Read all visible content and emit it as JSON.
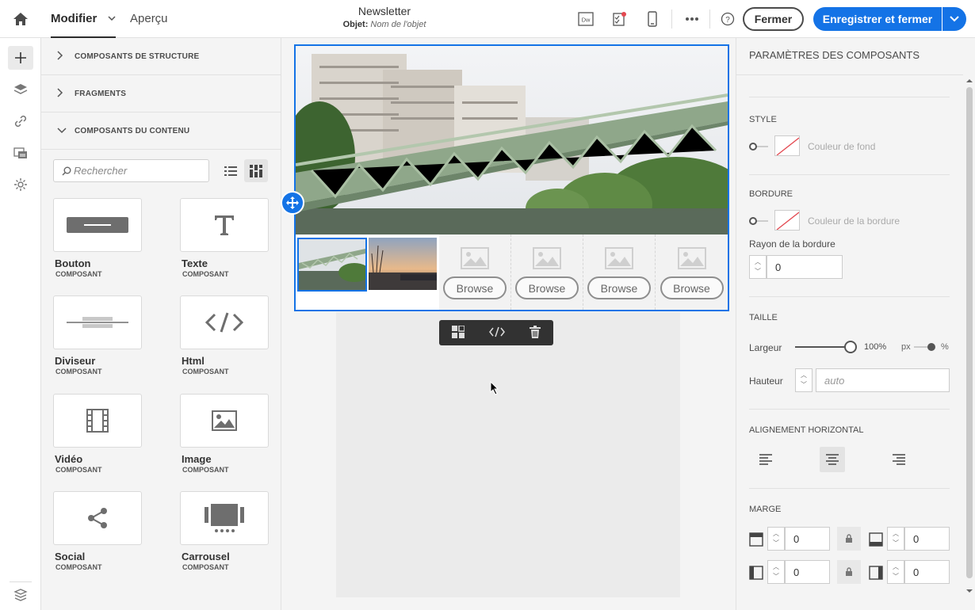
{
  "header": {
    "tab_modifier": "Modifier",
    "tab_apercu": "Aperçu",
    "title": "Newsletter",
    "subject_label": "Objet:",
    "subject_placeholder": "Nom de l'objet",
    "btn_fermer": "Fermer",
    "btn_save": "Enregistrer et fermer",
    "dw_icon": "Dw"
  },
  "panel": {
    "sections": [
      "COMPOSANTS DE STRUCTURE",
      "FRAGMENTS",
      "COMPOSANTS DU CONTENU"
    ],
    "search_placeholder": "Rechercher",
    "components": [
      {
        "name": "Bouton",
        "kind": "COMPOSANT",
        "icon": "button-icon"
      },
      {
        "name": "Texte",
        "kind": "COMPOSANT",
        "icon": "text-icon"
      },
      {
        "name": "Diviseur",
        "kind": "COMPOSANT",
        "icon": "divider-icon"
      },
      {
        "name": "Html",
        "kind": "COMPOSANT",
        "icon": "code-icon"
      },
      {
        "name": "Vidéo",
        "kind": "COMPOSANT",
        "icon": "video-icon"
      },
      {
        "name": "Image",
        "kind": "COMPOSANT",
        "icon": "image-icon"
      },
      {
        "name": "Social",
        "kind": "COMPOSANT",
        "icon": "share-icon"
      },
      {
        "name": "Carrousel",
        "kind": "COMPOSANT",
        "icon": "carousel-icon"
      }
    ]
  },
  "canvas": {
    "browse_labels": [
      "Browse",
      "Browse",
      "Browse",
      "Browse"
    ]
  },
  "props": {
    "title": "PARAMÈTRES DES COMPOSANTS",
    "style": {
      "title": "STYLE",
      "bg_label": "Couleur de fond"
    },
    "border": {
      "title": "BORDURE",
      "color_label": "Couleur de la bordure",
      "radius_label": "Rayon de la bordure",
      "radius_value": "0"
    },
    "size": {
      "title": "TAILLE",
      "width_label": "Largeur",
      "width_value": "100%",
      "unit_px": "px",
      "unit_pct": "%",
      "height_label": "Hauteur",
      "height_placeholder": "auto"
    },
    "align": {
      "title": "ALIGNEMENT HORIZONTAL",
      "selected": "center"
    },
    "margin": {
      "title": "MARGE",
      "top": "0",
      "bottom": "0",
      "left": "0",
      "right": "0"
    }
  },
  "colors": {
    "accent": "#1473e6",
    "toolbar": "#323232"
  }
}
